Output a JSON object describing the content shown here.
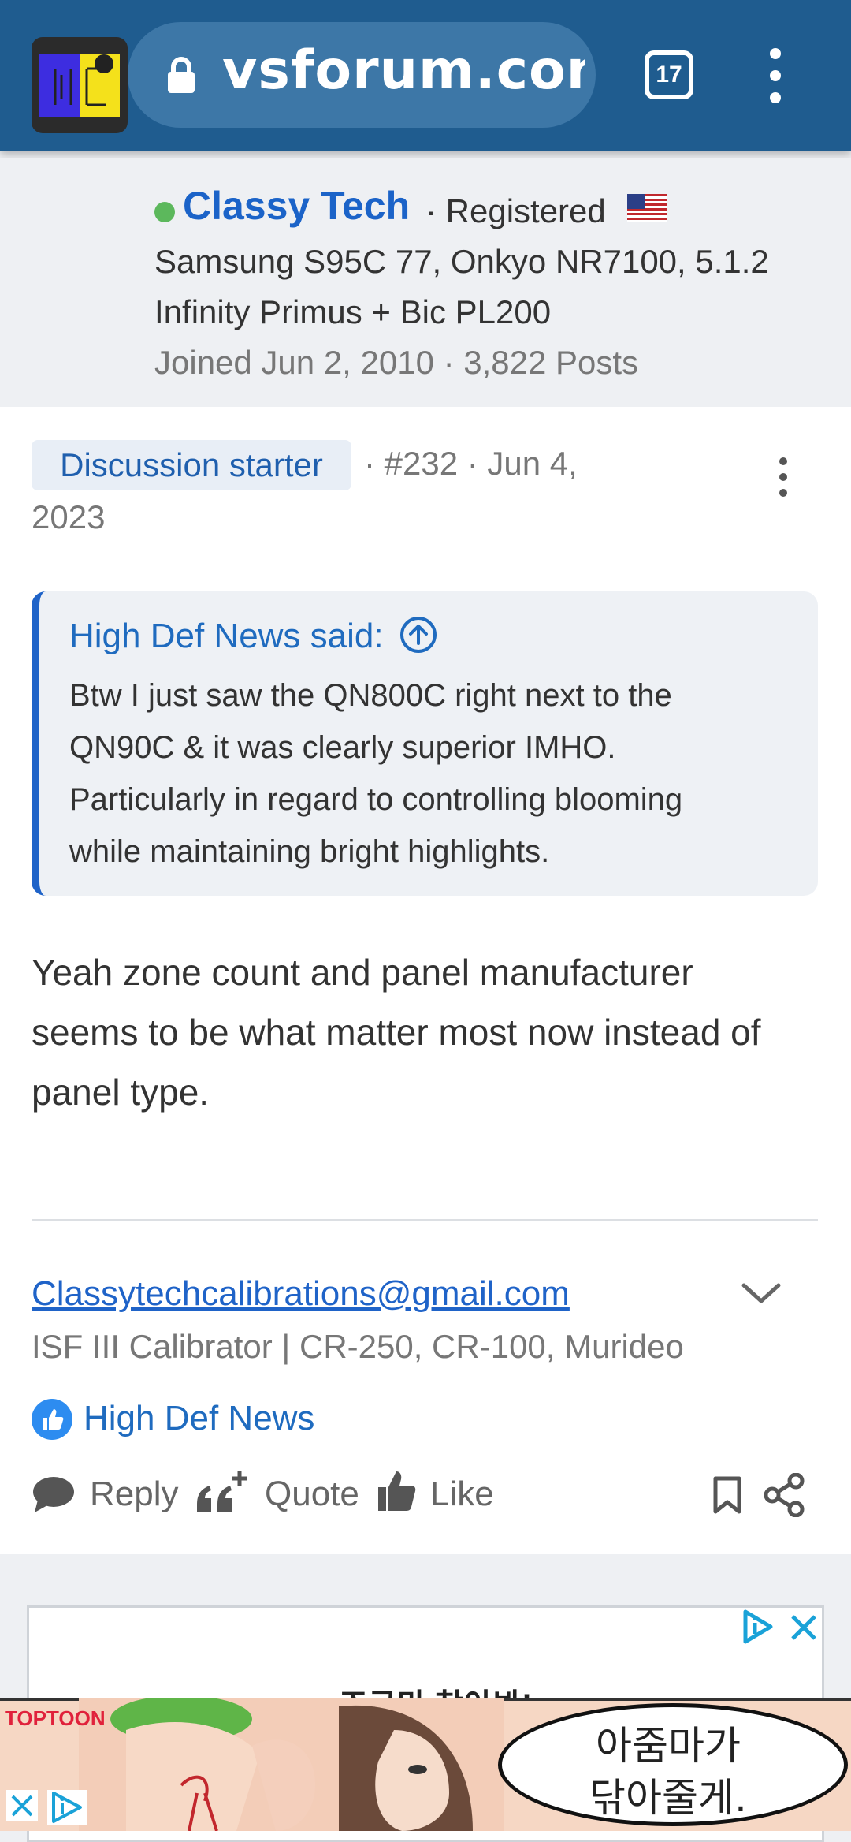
{
  "browser": {
    "url": "vsforum.com",
    "tab_count": "17"
  },
  "author": {
    "name": "Classy Tech",
    "role": "· Registered",
    "signature_line1": "Samsung S95C 77, Onkyo NR7100, 5.1.2",
    "signature_line2": "Infinity Primus + Bic PL200",
    "joined": "Joined Jun 2, 2010 · 3,822 Posts"
  },
  "post": {
    "badge": "Discussion starter",
    "meta_line1": "· #232 · Jun 4,",
    "meta_line2": "2023",
    "quote": {
      "author": "High Def News said:",
      "lines": [
        "Btw I just saw the QN800C right next to the",
        "QN90C & it was clearly superior IMHO.",
        "Particularly in regard to controlling blooming",
        "while maintaining bright highlights."
      ]
    },
    "body_lines": [
      "Yeah zone count and panel manufacturer",
      "seems to be what matter most now instead of",
      "panel type."
    ],
    "signature_email": "Classytechcalibrations@gmail.com",
    "signature_calibrator": "ISF III Calibrator | CR-250, CR-100, Murideo",
    "liked_by": "High Def News",
    "actions": {
      "reply": "Reply",
      "quote": "Quote",
      "like": "Like"
    }
  },
  "ads": {
    "top_text": "조금만 참아봐!",
    "bottom_logo": "TOPTOON",
    "bottom_bubble_line1": "아줌마가",
    "bottom_bubble_line2": "닦아줄게."
  },
  "colors": {
    "topbar": "#1f5c8f",
    "link": "#1f63c8",
    "online": "#5cb85c"
  }
}
